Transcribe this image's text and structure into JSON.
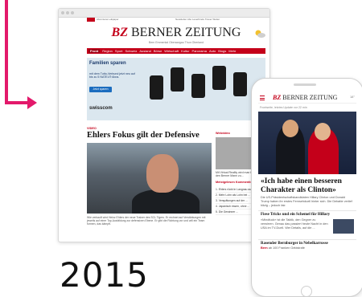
{
  "year_label": "2015",
  "accent_color": "#e3196b",
  "brand_color": "#c4001a",
  "desktop": {
    "logo_bz": "BZ",
    "logo_name": "BERNER ZEITUNG",
    "tagline": "Bern  Emmental  Oberaargau  Thun  Oberland",
    "top_links": "Abonnieren  eEpaper",
    "service_links": "Newsletter  Abo  Leserbriefe  Trauer  Wetter",
    "nav": [
      "Front",
      "Region",
      "Sport",
      "Schweiz",
      "Ausland",
      "Börse",
      "Wirtschaft",
      "Kultur",
      "Panorama",
      "Auto",
      "Blogs",
      "Mehr"
    ],
    "ad": {
      "title": "Familien sparen",
      "subtitle": "mit dem Tutto-Verbund jetzt neu auf bis zu 5 NATEL® Abos.",
      "button": "Jetzt sparen",
      "brand": "swisscom"
    },
    "article": {
      "ressort": "VIDEO",
      "headline": "Ehlers Fokus gilt der Defensive",
      "lead": "Wie verkauft wird Heinz Ehlers der neue Trainer des SCL Tigers. Er rechnet auf Verstärkungen mit jeweils auf einer Top-Ausbildung zur defensiven Ebene. Er gibt die Richtung vor und will ein Team formen, das kämpft."
    },
    "sidebar": {
      "label": "Webvideo",
      "text": "Mit Virtual Reality wird man blind auf den Berner Mann zu...",
      "list_label": "Meistgelesen  Kommentiert",
      "list": [
        "1. Ehlers rückt in Langnau auf ...",
        "2. Mehr Lohn als Lohn bei ...",
        "3. Verspätungen auf der ...",
        "4. Japanisch essen, ohne ...",
        "5. Die Gewinner ..."
      ]
    }
  },
  "mobile": {
    "logo_bz": "BZ",
    "logo_name": "BERNER ZEITUNG",
    "weather": "18°",
    "crumb": "Frontseite, letztes Update vor 22 min",
    "headline": "«Ich habe einen besseren Charakter als Clinton»",
    "text": "Die US-Präsidentschaftskandidaten Hillary Clinton und Donald Trump haben ihr erstes Fernsehduell hinter sich. Die Debatte verlief hitzig – jedoch fair.",
    "second_headline": "Fiese Tricks und ein Schemel für Hillary",
    "second_text": "«Mindfuck» ist die Taktik, den Gegner zu verwirren. Genau das passiert heute Nacht in den USA im TV-Duell. Wer Details, auf die ...",
    "third_headline": "Rasender Bernburger in Nebelkarrosse",
    "bottom_label": "Bern",
    "bottom_text": "ab 100 Franken Geldstrafe"
  }
}
